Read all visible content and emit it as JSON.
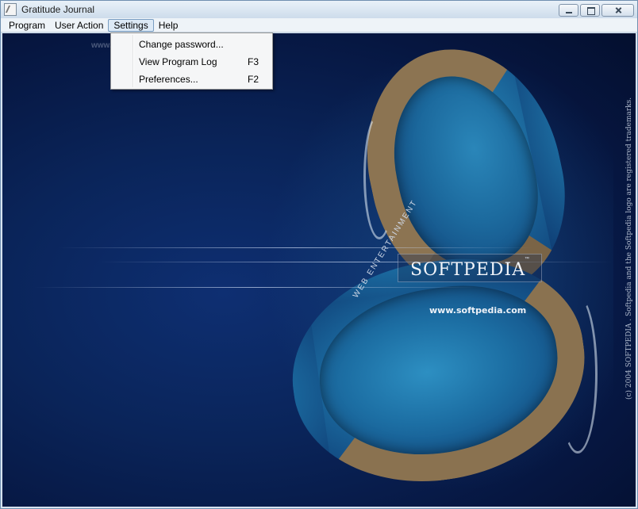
{
  "window": {
    "title": "Gratitude Journal"
  },
  "menubar": {
    "items": [
      "Program",
      "User Action",
      "Settings",
      "Help"
    ]
  },
  "settings_menu": {
    "items": [
      {
        "label": "Change password...",
        "shortcut": ""
      },
      {
        "label": "View Program Log",
        "shortcut": "F3"
      },
      {
        "label": "Preferences...",
        "shortcut": "F2"
      }
    ]
  },
  "splash": {
    "logo": "SOFTPEDIA",
    "trademark": "™",
    "tagline": "WEB ENTERTAINMENT",
    "url": "www.softpedia.com",
    "watermark": "www.softpedia.com",
    "copyright": "(c) 2004 SOFTPEDIA . Softpedia and the Softpedia logo are registered trademarks."
  },
  "colors": {
    "accent": "#7a9ec2",
    "background": "#0a2459",
    "island": "#8c7452"
  }
}
